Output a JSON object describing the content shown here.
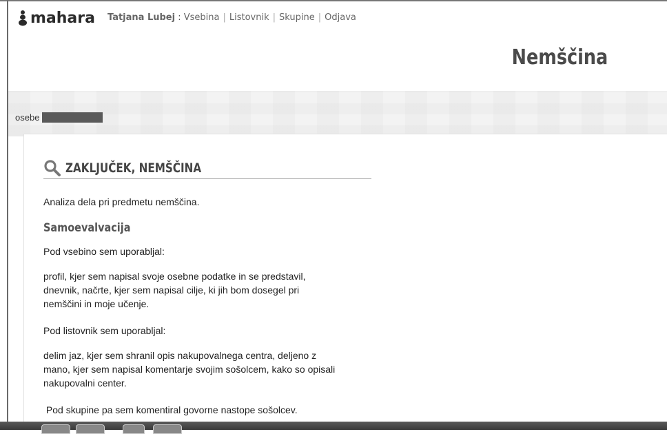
{
  "header": {
    "logo_text": "mahara",
    "user_name": "Tatjana Lubej",
    "user_suffix": " :",
    "nav": [
      "Vsebina",
      "Listovnik",
      "Skupine",
      "Odjava"
    ],
    "site_title": "Nemščina"
  },
  "owner": {
    "label": "osebe"
  },
  "view": {
    "title": "ZAKLJUČEK, NEMŠČINA",
    "intro": "Analiza dela pri predmetu nemščina.",
    "subheading": "Samoevalvacija",
    "paragraphs": [
      "Pod vsebino sem uporabljal:",
      [
        "profil, kjer sem napisal svoje osebne podatke in se predstavil,",
        "dnevnik, načrte, kjer sem napisal cilje, ki jih bom dosegel pri",
        "nemščini in moje učenje."
      ],
      "Pod listovnik sem uporabljal:",
      [
        "delim jaz, kjer sem shranil opis nakupovalnega centra, deljeno z",
        "mano, kjer sem napisal komentarje svojim sošolcem, kako so opisali",
        "nakupovalni center."
      ],
      " Pod skupine pa sem komentiral govorne nastope sošolcev."
    ]
  }
}
